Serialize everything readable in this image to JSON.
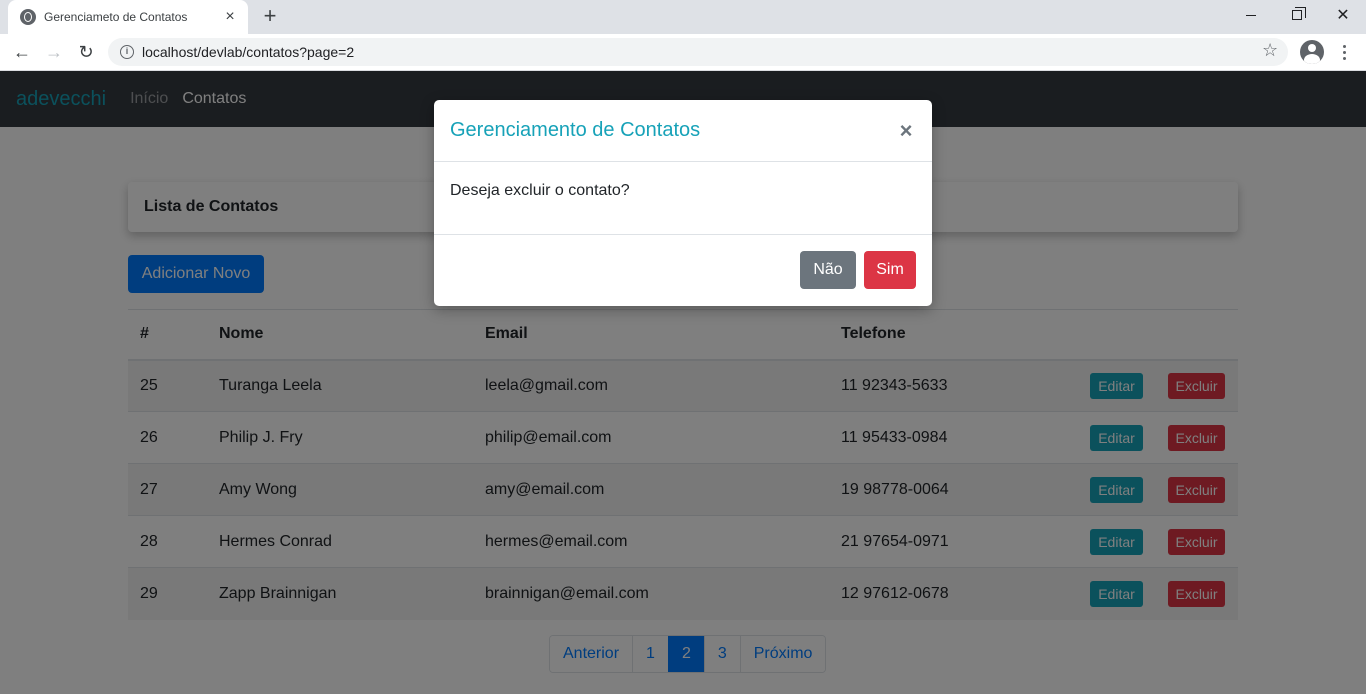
{
  "browser": {
    "tab_title": "Gerenciameto de Contatos",
    "tab_close": "×",
    "new_tab": "+",
    "url": "localhost/devlab/contatos?page=2"
  },
  "app": {
    "brand": "adevecchi",
    "nav": [
      {
        "label": "Início",
        "active": false
      },
      {
        "label": "Contatos",
        "active": true
      }
    ]
  },
  "card": {
    "title": "Lista de Contatos"
  },
  "add_button": "Adicionar Novo",
  "table": {
    "headers": [
      "#",
      "Nome",
      "Email",
      "Telefone",
      ""
    ],
    "rows": [
      {
        "id": "25",
        "nome": "Turanga Leela",
        "email": "leela@gmail.com",
        "telefone": "11 92343-5633"
      },
      {
        "id": "26",
        "nome": "Philip J. Fry",
        "email": "philip@email.com",
        "telefone": "11 95433-0984"
      },
      {
        "id": "27",
        "nome": "Amy Wong",
        "email": "amy@email.com",
        "telefone": "19 98778-0064"
      },
      {
        "id": "28",
        "nome": "Hermes Conrad",
        "email": "hermes@email.com",
        "telefone": "21 97654-0971"
      },
      {
        "id": "29",
        "nome": "Zapp Brainnigan",
        "email": "brainnigan@email.com",
        "telefone": "12 97612-0678"
      }
    ],
    "edit_label": "Editar",
    "delete_label": "Excluir"
  },
  "pagination": {
    "prev": "Anterior",
    "pages": [
      "1",
      "2",
      "3"
    ],
    "current": "2",
    "next": "Próximo"
  },
  "modal": {
    "title": "Gerenciamento de Contatos",
    "close": "×",
    "body": "Deseja excluir o contato?",
    "no_label": "Não",
    "yes_label": "Sim"
  },
  "colors": {
    "navbar": "#343a40",
    "brand": "#17a2b8",
    "primary": "#007bff",
    "info": "#17a2b8",
    "danger": "#dc3545",
    "secondary": "#6c757d"
  }
}
